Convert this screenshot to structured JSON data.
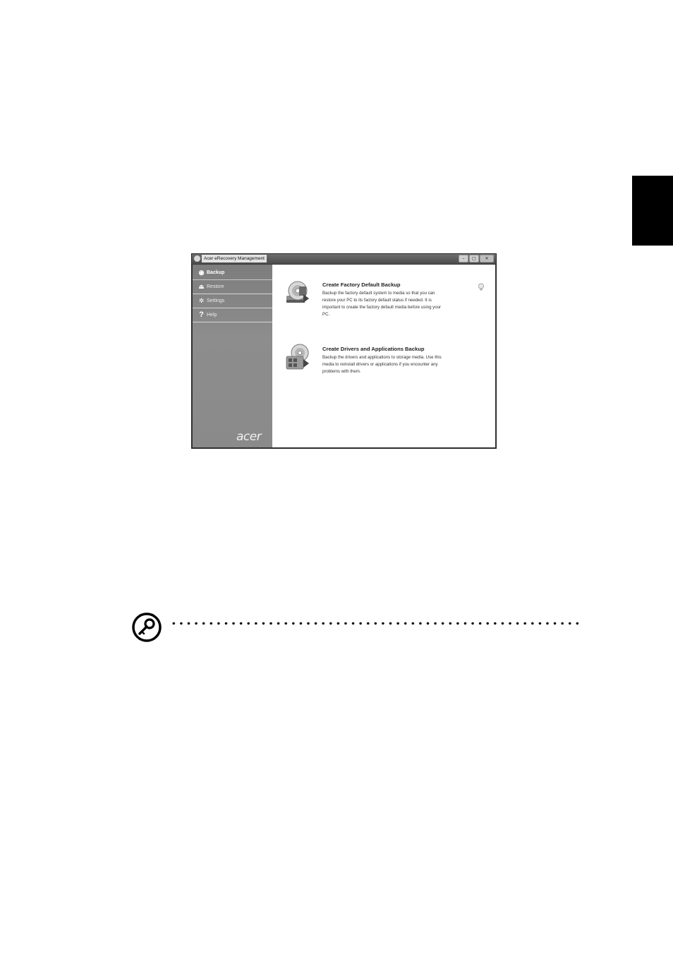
{
  "window": {
    "title": "Acer eRecovery Management",
    "buttons": {
      "minimize": "–",
      "maximize": "□",
      "close": "✕"
    }
  },
  "sidebar": {
    "items": [
      {
        "label": "Backup",
        "icon": "backup-disc-icon",
        "active": true
      },
      {
        "label": "Restore",
        "icon": "restore-icon",
        "active": false
      },
      {
        "label": "Settings",
        "icon": "gear-icon",
        "active": false
      },
      {
        "label": "Help",
        "icon": "question-icon",
        "active": false
      }
    ],
    "logo": "acer"
  },
  "main": {
    "items": [
      {
        "title": "Create Factory Default Backup",
        "lines": [
          "Backup the factory default system to media so that you can",
          "restore your PC to its factory default status if needed. It is",
          "important to create the factory default media before using  your",
          "PC."
        ],
        "icon": "factory-backup-disc-icon"
      },
      {
        "title": "Create Drivers and Applications Backup",
        "lines": [
          "Backup the drivers and applications to storage media. Use this",
          "media to reinstall drivers or applications if you encounter any",
          "problems with them."
        ],
        "icon": "drivers-apps-backup-icon"
      }
    ]
  },
  "note": {
    "icon": "key-note-icon"
  },
  "colors": {
    "page": "#ffffff",
    "sidebar": "#8a8a8a",
    "tab": "#000000"
  }
}
